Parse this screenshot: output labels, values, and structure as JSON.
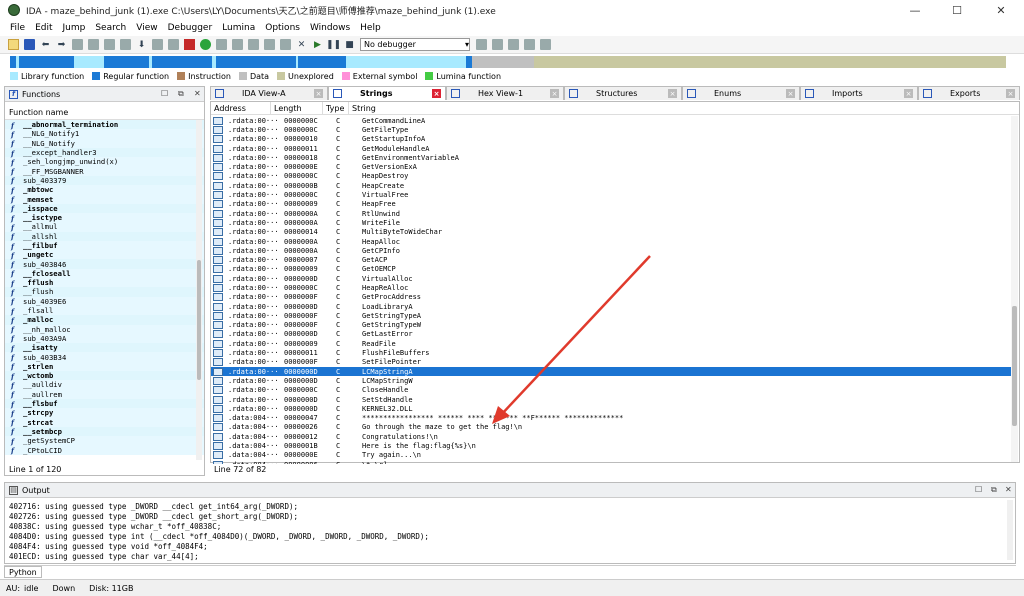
{
  "window": {
    "title": "IDA - maze_behind_junk (1).exe C:\\Users\\LY\\Documents\\天乙\\之前题目\\师傅推荐\\maze_behind_junk (1).exe",
    "min_glyph": "—",
    "max_glyph": "☐",
    "close_glyph": "✕"
  },
  "menu": [
    "File",
    "Edit",
    "Jump",
    "Search",
    "View",
    "Debugger",
    "Lumina",
    "Options",
    "Windows",
    "Help"
  ],
  "toolbar": {
    "debugger_select": "No debugger"
  },
  "legend": [
    {
      "label": "Library function",
      "color": "#a8eaff"
    },
    {
      "label": "Regular function",
      "color": "#1b7ad6"
    },
    {
      "label": "Instruction",
      "color": "#b08058"
    },
    {
      "label": "Data",
      "color": "#c0c0c0"
    },
    {
      "label": "Unexplored",
      "color": "#c8c8a0"
    },
    {
      "label": "External symbol",
      "color": "#ff90d8"
    },
    {
      "label": "Lumina function",
      "color": "#44cc44"
    }
  ],
  "functions_panel": {
    "title": "Functions",
    "column": "Function name",
    "items": [
      {
        "name": "__abnormal_termination",
        "bold": true
      },
      {
        "name": "__NLG_Notify1",
        "bold": false
      },
      {
        "name": "__NLG_Notify",
        "bold": false
      },
      {
        "name": "__except_handler3",
        "bold": false
      },
      {
        "name": "_seh_longjmp_unwind(x)",
        "bold": false
      },
      {
        "name": "__FF_MSGBANNER",
        "bold": false
      },
      {
        "name": "sub_403379",
        "bold": false
      },
      {
        "name": "_mbtowc",
        "bold": true
      },
      {
        "name": "_memset",
        "bold": true
      },
      {
        "name": "_isspace",
        "bold": true
      },
      {
        "name": "__isctype",
        "bold": true
      },
      {
        "name": "__allmul",
        "bold": false
      },
      {
        "name": "__allshl",
        "bold": false
      },
      {
        "name": "__filbuf",
        "bold": true
      },
      {
        "name": "_ungetc",
        "bold": true
      },
      {
        "name": "sub_403846",
        "bold": false
      },
      {
        "name": "__fcloseall",
        "bold": true
      },
      {
        "name": "_fflush",
        "bold": true
      },
      {
        "name": "__flush",
        "bold": false
      },
      {
        "name": "sub_4039E6",
        "bold": false
      },
      {
        "name": "_flsall",
        "bold": false
      },
      {
        "name": "_malloc",
        "bold": true
      },
      {
        "name": "__nh_malloc",
        "bold": false
      },
      {
        "name": "sub_403A9A",
        "bold": false
      },
      {
        "name": "__isatty",
        "bold": true
      },
      {
        "name": "sub_403B34",
        "bold": false
      },
      {
        "name": "_strlen",
        "bold": true
      },
      {
        "name": "_wctomb",
        "bold": true
      },
      {
        "name": "__aulldiv",
        "bold": false
      },
      {
        "name": "__aullrem",
        "bold": false
      },
      {
        "name": "__flsbuf",
        "bold": true
      },
      {
        "name": "_strcpy",
        "bold": true
      },
      {
        "name": "_strcat",
        "bold": true
      },
      {
        "name": "__setmbcp",
        "bold": true
      },
      {
        "name": "_getSystemCP",
        "bold": false
      },
      {
        "name": "_CPtoLCID",
        "bold": false
      }
    ],
    "status": "Line 1 of 120"
  },
  "tabs": [
    {
      "label": "IDA View-A",
      "active": false,
      "closable": false
    },
    {
      "label": "Strings",
      "active": true,
      "closable": true
    },
    {
      "label": "Hex View-1",
      "active": false,
      "closable": false
    },
    {
      "label": "Structures",
      "active": false,
      "closable": false
    },
    {
      "label": "Enums",
      "active": false,
      "closable": false
    },
    {
      "label": "Imports",
      "active": false,
      "closable": false
    },
    {
      "label": "Exports",
      "active": false,
      "closable": false
    }
  ],
  "strings_panel": {
    "columns": [
      "Address",
      "Length",
      "Type",
      "String"
    ],
    "rows": [
      {
        "addr": ".rdata:00···",
        "len": "0000000C",
        "type": "C",
        "val": "GetCommandLineA"
      },
      {
        "addr": ".rdata:00···",
        "len": "0000000C",
        "type": "C",
        "val": "GetFileType"
      },
      {
        "addr": ".rdata:00···",
        "len": "00000010",
        "type": "C",
        "val": "GetStartupInfoA"
      },
      {
        "addr": ".rdata:00···",
        "len": "00000011",
        "type": "C",
        "val": "GetModuleHandleA"
      },
      {
        "addr": ".rdata:00···",
        "len": "00000018",
        "type": "C",
        "val": "GetEnvironmentVariableA"
      },
      {
        "addr": ".rdata:00···",
        "len": "0000000E",
        "type": "C",
        "val": "GetVersionExA"
      },
      {
        "addr": ".rdata:00···",
        "len": "0000000C",
        "type": "C",
        "val": "HeapDestroy"
      },
      {
        "addr": ".rdata:00···",
        "len": "0000000B",
        "type": "C",
        "val": "HeapCreate"
      },
      {
        "addr": ".rdata:00···",
        "len": "0000000C",
        "type": "C",
        "val": "VirtualFree"
      },
      {
        "addr": ".rdata:00···",
        "len": "00000009",
        "type": "C",
        "val": "HeapFree"
      },
      {
        "addr": ".rdata:00···",
        "len": "0000000A",
        "type": "C",
        "val": "RtlUnwind"
      },
      {
        "addr": ".rdata:00···",
        "len": "0000000A",
        "type": "C",
        "val": "WriteFile"
      },
      {
        "addr": ".rdata:00···",
        "len": "00000014",
        "type": "C",
        "val": "MultiByteToWideChar"
      },
      {
        "addr": ".rdata:00···",
        "len": "0000000A",
        "type": "C",
        "val": "HeapAlloc"
      },
      {
        "addr": ".rdata:00···",
        "len": "0000000A",
        "type": "C",
        "val": "GetCPInfo"
      },
      {
        "addr": ".rdata:00···",
        "len": "00000007",
        "type": "C",
        "val": "GetACP"
      },
      {
        "addr": ".rdata:00···",
        "len": "00000009",
        "type": "C",
        "val": "GetOEMCP"
      },
      {
        "addr": ".rdata:00···",
        "len": "0000000D",
        "type": "C",
        "val": "VirtualAlloc"
      },
      {
        "addr": ".rdata:00···",
        "len": "0000000C",
        "type": "C",
        "val": "HeapReAlloc"
      },
      {
        "addr": ".rdata:00···",
        "len": "0000000F",
        "type": "C",
        "val": "GetProcAddress"
      },
      {
        "addr": ".rdata:00···",
        "len": "0000000D",
        "type": "C",
        "val": "LoadLibraryA"
      },
      {
        "addr": ".rdata:00···",
        "len": "0000000F",
        "type": "C",
        "val": "GetStringTypeA"
      },
      {
        "addr": ".rdata:00···",
        "len": "0000000F",
        "type": "C",
        "val": "GetStringTypeW"
      },
      {
        "addr": ".rdata:00···",
        "len": "0000000D",
        "type": "C",
        "val": "GetLastError"
      },
      {
        "addr": ".rdata:00···",
        "len": "00000009",
        "type": "C",
        "val": "ReadFile"
      },
      {
        "addr": ".rdata:00···",
        "len": "00000011",
        "type": "C",
        "val": "FlushFileBuffers"
      },
      {
        "addr": ".rdata:00···",
        "len": "0000000F",
        "type": "C",
        "val": "SetFilePointer"
      },
      {
        "addr": ".rdata:00···",
        "len": "0000000D",
        "type": "C",
        "val": "LCMapStringA",
        "selected": true
      },
      {
        "addr": ".rdata:00···",
        "len": "0000000D",
        "type": "C",
        "val": "LCMapStringW"
      },
      {
        "addr": ".rdata:00···",
        "len": "0000000C",
        "type": "C",
        "val": "CloseHandle"
      },
      {
        "addr": ".rdata:00···",
        "len": "0000000D",
        "type": "C",
        "val": "SetStdHandle"
      },
      {
        "addr": ".rdata:00···",
        "len": "0000000D",
        "type": "C",
        "val": "KERNEL32.DLL"
      },
      {
        "addr": ".data:004···",
        "len": "00000047",
        "type": "C",
        "val": "*****************  ******    ****    *******  **F******     **************"
      },
      {
        "addr": ".data:004···",
        "len": "00000026",
        "type": "C",
        "val": "Go through the maze to get the flag!\\n"
      },
      {
        "addr": ".data:004···",
        "len": "00000012",
        "type": "C",
        "val": "Congratulations!\\n"
      },
      {
        "addr": ".data:004···",
        "len": "0000001B",
        "type": "C",
        "val": "Here is the flag:flag{%s}\\n"
      },
      {
        "addr": ".data:004···",
        "len": "0000000E",
        "type": "C",
        "val": "Try again...\\n"
      },
      {
        "addr": ".data:004···",
        "len": "00000006",
        "type": "C",
        "val": " \\t-\\r]"
      }
    ],
    "status": "Line 72 of 82"
  },
  "output_panel": {
    "title": "Output",
    "lines": [
      "402716: using guessed type _DWORD __cdecl get_int64_arg(_DWORD);",
      "402726: using guessed type _DWORD __cdecl get_short_arg(_DWORD);",
      "40838C: using guessed type wchar_t *off_40838C;",
      "4084D0: using guessed type int (__cdecl *off_4084D0)(_DWORD, _DWORD, _DWORD, _DWORD, _DWORD);",
      "4084F4: using guessed type void *off_4084F4;",
      "401ECD: using guessed type char var_44[4];"
    ],
    "tab": "Python"
  },
  "statusbar": {
    "au": "AU:",
    "state": "idle",
    "direction": "Down",
    "disk": "Disk: 11GB"
  }
}
